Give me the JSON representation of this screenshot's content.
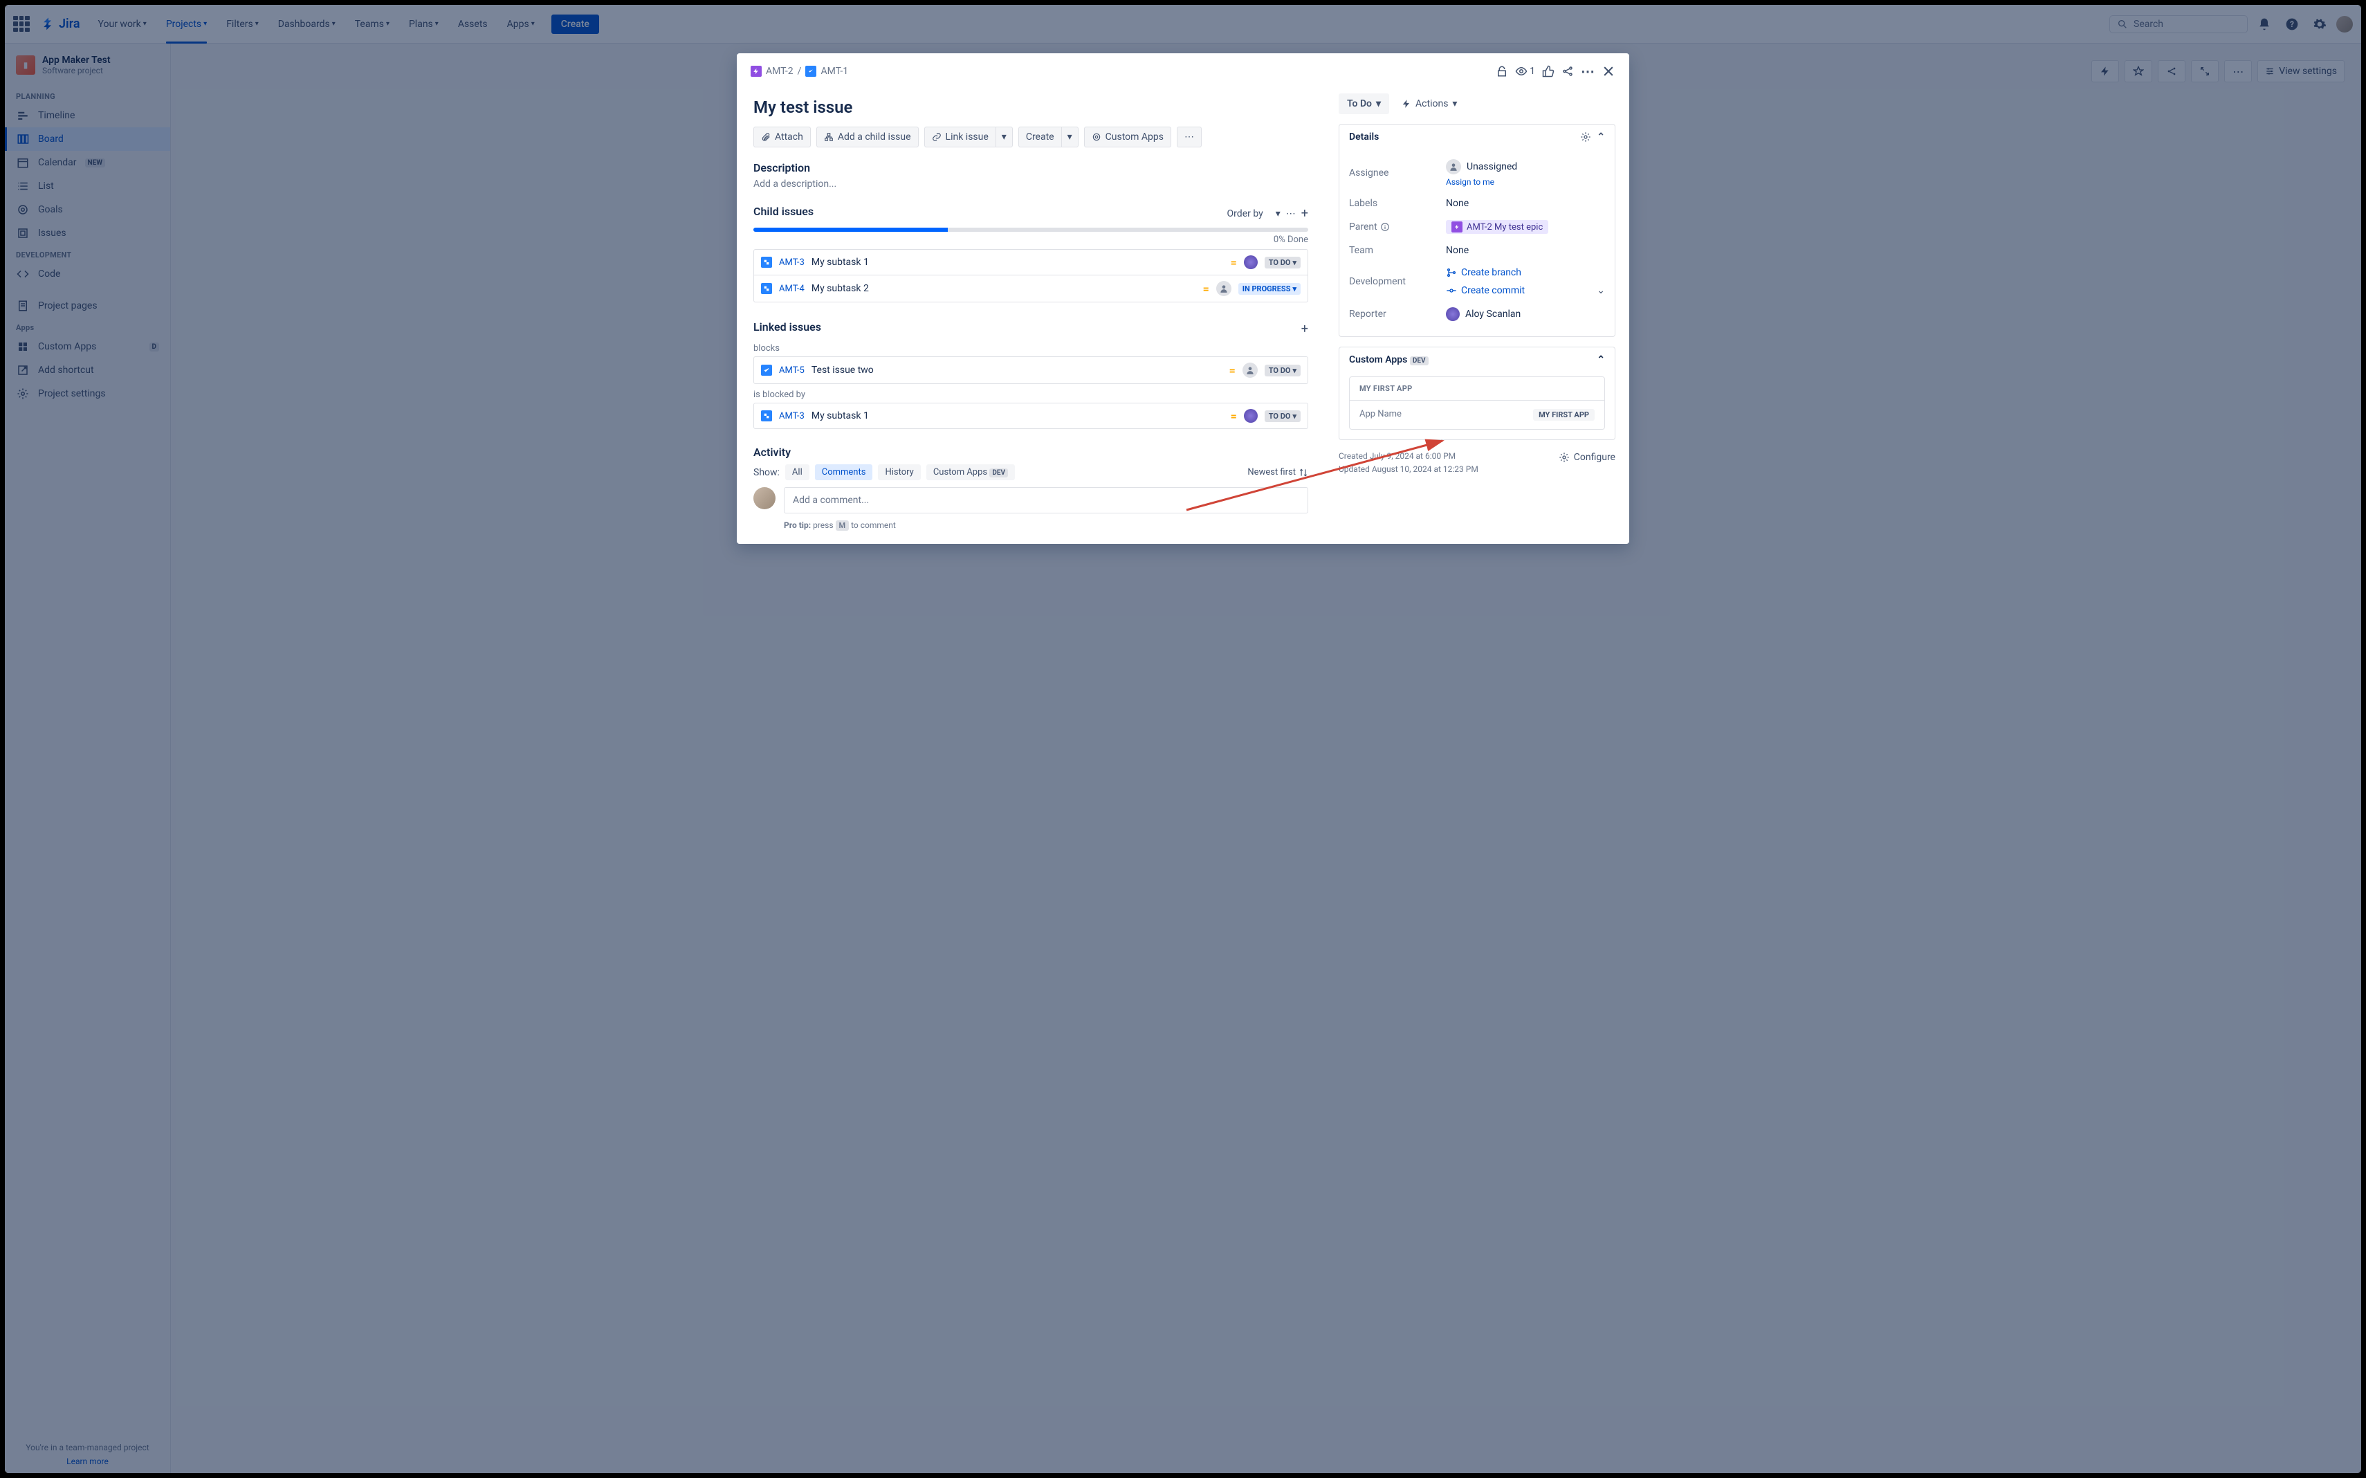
{
  "topnav": {
    "logo": "Jira",
    "items": [
      "Your work",
      "Projects",
      "Filters",
      "Dashboards",
      "Teams",
      "Plans",
      "Assets",
      "Apps"
    ],
    "create": "Create",
    "search_placeholder": "Search"
  },
  "sidebar": {
    "project_name": "App Maker Test",
    "project_sub": "Software project",
    "groups": {
      "planning": {
        "label": "PLANNING",
        "items": [
          "Timeline",
          "Board",
          "Calendar",
          "List",
          "Goals",
          "Issues"
        ],
        "calendar_badge": "NEW"
      },
      "development": {
        "label": "DEVELOPMENT",
        "items": [
          "Code"
        ]
      },
      "other": [
        "Project pages"
      ],
      "apps": {
        "label": "Apps",
        "items": [
          "Custom Apps",
          "Add shortcut",
          "Project settings"
        ],
        "custom_apps_badge": "D"
      }
    },
    "footer_text": "You're in a team-managed project",
    "footer_link": "Learn more"
  },
  "main_bg": {
    "view_settings": "View settings"
  },
  "modal": {
    "breadcrumb": [
      {
        "key": "AMT-2",
        "type": "epic"
      },
      {
        "key": "AMT-1",
        "type": "task"
      }
    ],
    "watchers": "1",
    "title": "My test issue",
    "actions": {
      "attach": "Attach",
      "add_child": "Add a child issue",
      "link": "Link issue",
      "create": "Create",
      "custom": "Custom Apps"
    },
    "description": {
      "heading": "Description",
      "placeholder": "Add a description..."
    },
    "child": {
      "heading": "Child issues",
      "order_by": "Order by",
      "progress_label": "0% Done",
      "items": [
        {
          "key": "AMT-3",
          "summary": "My subtask 1",
          "status": "TO DO",
          "assignee_type": "avatar"
        },
        {
          "key": "AMT-4",
          "summary": "My subtask 2",
          "status": "IN PROGRESS",
          "assignee_type": "unassigned"
        }
      ]
    },
    "linked": {
      "heading": "Linked issues",
      "blocks_label": "blocks",
      "blocked_by_label": "is blocked by",
      "blocks": [
        {
          "key": "AMT-5",
          "summary": "Test issue two",
          "status": "TO DO"
        }
      ],
      "blocked_by": [
        {
          "key": "AMT-3",
          "summary": "My subtask 1",
          "status": "TO DO"
        }
      ]
    },
    "activity": {
      "heading": "Activity",
      "show_label": "Show:",
      "tabs": [
        "All",
        "Comments",
        "History",
        "Custom Apps"
      ],
      "custom_badge": "DEV",
      "newest": "Newest first",
      "comment_placeholder": "Add a comment...",
      "protip_label": "Pro tip:",
      "protip_press": "press",
      "protip_key": "M",
      "protip_rest": "to comment"
    },
    "right": {
      "status": "To Do",
      "actions": "Actions",
      "details": {
        "heading": "Details",
        "assignee_label": "Assignee",
        "assignee_value": "Unassigned",
        "assign_to_me": "Assign to me",
        "labels_label": "Labels",
        "labels_value": "None",
        "parent_label": "Parent",
        "parent_value": "AMT-2 My test epic",
        "team_label": "Team",
        "team_value": "None",
        "dev_label": "Development",
        "create_branch": "Create branch",
        "create_commit": "Create commit",
        "reporter_label": "Reporter",
        "reporter_value": "Aloy Scanlan"
      },
      "custom_panel": {
        "heading": "Custom Apps",
        "badge": "DEV",
        "app_title": "MY FIRST APP",
        "field_label": "App Name",
        "field_value": "MY FIRST APP"
      },
      "created": "Created July 9, 2024 at 6:00 PM",
      "updated": "Updated August 10, 2024 at 12:23 PM",
      "configure": "Configure"
    }
  }
}
